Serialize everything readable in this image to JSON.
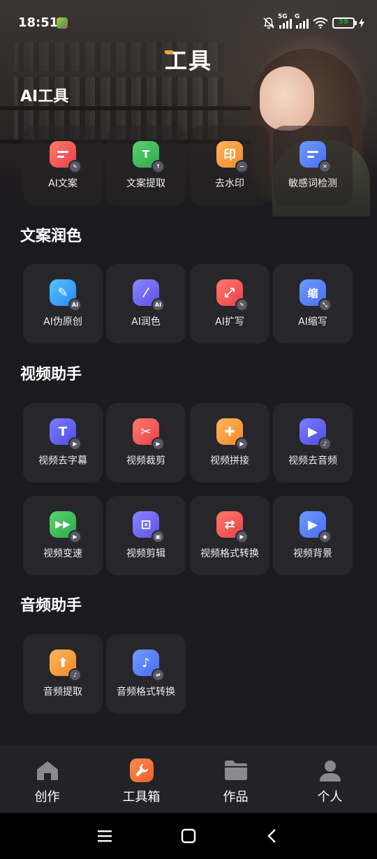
{
  "status_bar": {
    "time": "18:51",
    "battery": "59",
    "net1": "5G",
    "net2": "G"
  },
  "header": {
    "title": "工具"
  },
  "sections": [
    {
      "title": "AI工具",
      "tools": [
        {
          "label": "AI文案",
          "icon": "doc-edit-icon"
        },
        {
          "label": "文案提取",
          "icon": "text-extract-icon"
        },
        {
          "label": "去水印",
          "icon": "watermark-remove-icon",
          "glyph": "印"
        },
        {
          "label": "敏感词检测",
          "icon": "sensitive-word-icon"
        }
      ]
    },
    {
      "title": "文案润色",
      "tools": [
        {
          "label": "AI伪原创",
          "icon": "pen-ai-icon"
        },
        {
          "label": "AI润色",
          "icon": "magic-wand-ai-icon"
        },
        {
          "label": "AI扩写",
          "icon": "expand-edit-icon"
        },
        {
          "label": "AI缩写",
          "icon": "shrink-icon",
          "glyph": "缩"
        }
      ]
    },
    {
      "title": "视频助手",
      "tools": [
        {
          "label": "视频去字幕",
          "icon": "subtitle-remove-icon",
          "glyph": "T"
        },
        {
          "label": "视频裁剪",
          "icon": "scissors-icon",
          "glyph": "✂"
        },
        {
          "label": "视频拼接",
          "icon": "puzzle-icon",
          "glyph": "✚"
        },
        {
          "label": "视频去音频",
          "icon": "audio-remove-icon",
          "glyph": "▶"
        },
        {
          "label": "视频变速",
          "icon": "speed-icon",
          "glyph": "▶▶"
        },
        {
          "label": "视频剪辑",
          "icon": "crop-icon",
          "glyph": "⊡"
        },
        {
          "label": "视频格式转换",
          "icon": "format-convert-icon",
          "glyph": "⇄"
        },
        {
          "label": "视频背景",
          "icon": "video-background-icon",
          "glyph": "▶"
        }
      ]
    },
    {
      "title": "音频助手",
      "tools": [
        {
          "label": "音频提取",
          "icon": "audio-extract-icon",
          "glyph": "⬆"
        },
        {
          "label": "音频格式转换",
          "icon": "audio-convert-icon",
          "glyph": "♪"
        }
      ]
    }
  ],
  "tab_bar": [
    {
      "label": "创作",
      "icon": "home-icon",
      "color": "#8a8a92"
    },
    {
      "label": "工具箱",
      "icon": "wrench-icon",
      "color": "#ff7a3d"
    },
    {
      "label": "作品",
      "icon": "folder-icon",
      "color": "#8a8a92"
    },
    {
      "label": "个人",
      "icon": "person-icon",
      "color": "#8a8a92"
    }
  ]
}
